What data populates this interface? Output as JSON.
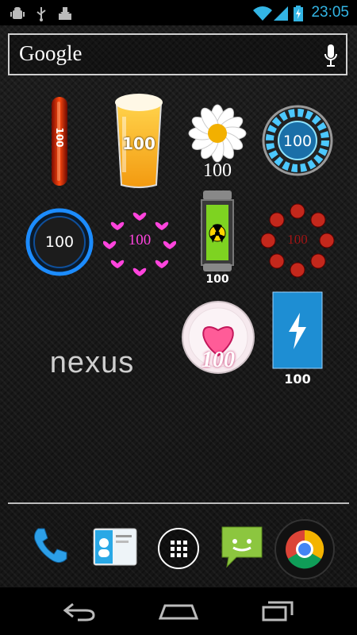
{
  "status_bar": {
    "time": "23:05",
    "left_icons": [
      "android-debug-icon",
      "usb-icon",
      "download-icon"
    ],
    "right_icons": [
      "wifi-icon",
      "signal-icon",
      "battery-icon"
    ]
  },
  "search": {
    "logo": "Google",
    "mic_icon": "mic-icon"
  },
  "widgets": {
    "thermometer": "100",
    "beer": "100",
    "daisy": "100",
    "arc_reactor": "100",
    "blue_ring": "100",
    "hearts_ring": "100",
    "radioactive": "100",
    "skull_ring": "100",
    "heart_plate": "100",
    "bolt_battery": "100"
  },
  "nexus_wallpaper_text": "nexus",
  "dock": [
    "phone-icon",
    "contacts-icon",
    "app-drawer-icon",
    "messaging-icon",
    "chrome-icon"
  ],
  "nav": [
    "back-button",
    "home-button",
    "recents-button"
  ],
  "colors": {
    "accent": "#33b5e5",
    "background": "#1a1a1a"
  }
}
